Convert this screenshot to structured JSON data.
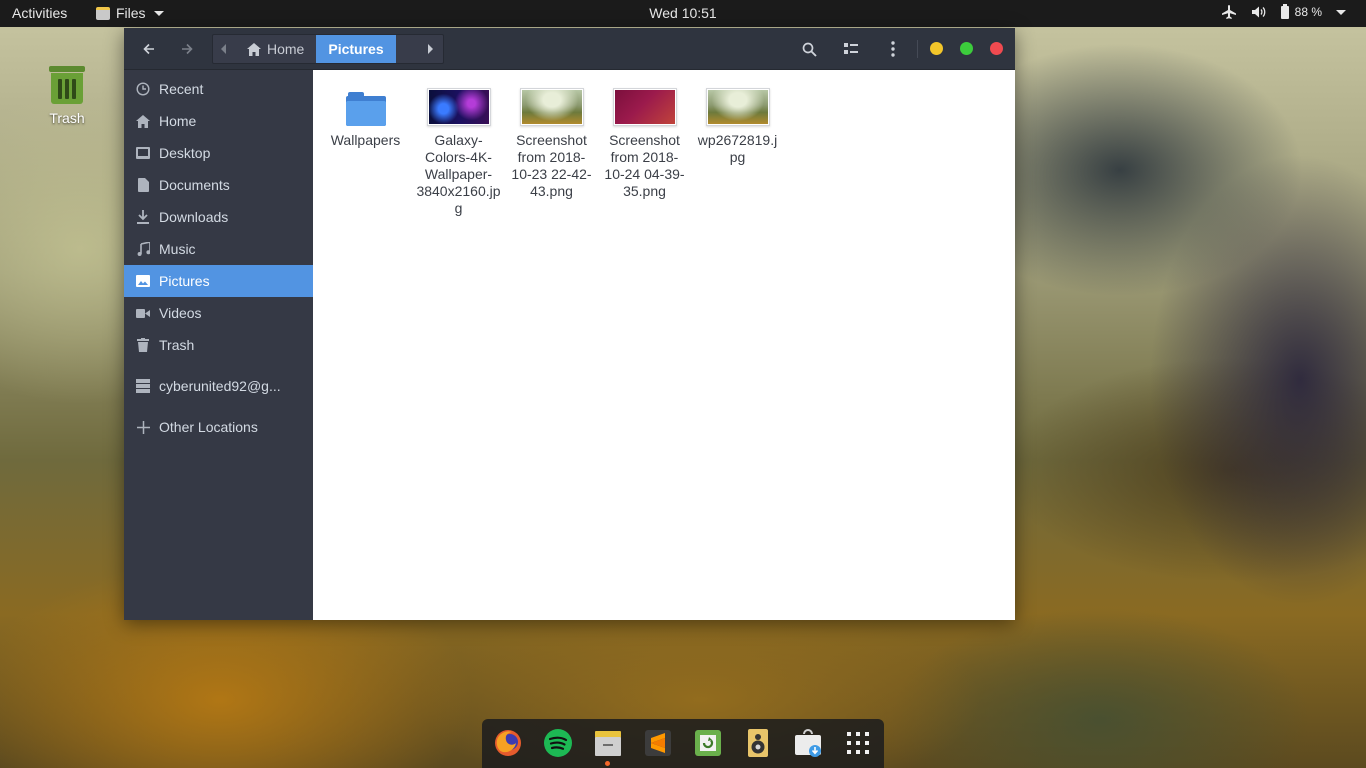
{
  "topbar": {
    "activities": "Activities",
    "app_name": "Files",
    "clock": "Wed 10:51",
    "battery_percent": "88 %"
  },
  "desktop": {
    "trash_label": "Trash"
  },
  "window": {
    "path": {
      "home": "Home",
      "current": "Pictures"
    },
    "sidebar": {
      "items": [
        {
          "label": "Recent",
          "icon": "clock-icon"
        },
        {
          "label": "Home",
          "icon": "home-icon"
        },
        {
          "label": "Desktop",
          "icon": "desktop-icon"
        },
        {
          "label": "Documents",
          "icon": "document-icon"
        },
        {
          "label": "Downloads",
          "icon": "download-icon"
        },
        {
          "label": "Music",
          "icon": "music-icon"
        },
        {
          "label": "Pictures",
          "icon": "image-icon"
        },
        {
          "label": "Videos",
          "icon": "video-icon"
        },
        {
          "label": "Trash",
          "icon": "trash-icon"
        }
      ],
      "network_item": "cyberunited92@g...",
      "other_locations": "Other Locations"
    },
    "files": [
      {
        "name": "Wallpapers",
        "type": "folder"
      },
      {
        "name": "Galaxy-Colors-4K-Wallpaper-3840x2160.jpg",
        "type": "image"
      },
      {
        "name": "Screenshot from 2018-10-23 22-42-43.png",
        "type": "image"
      },
      {
        "name": "Screenshot from 2018-10-24 04-39-35.png",
        "type": "image"
      },
      {
        "name": "wp2672819.jpg",
        "type": "image"
      }
    ]
  },
  "dock": {
    "apps": [
      "firefox-icon",
      "spotify-icon",
      "files-icon",
      "sublime-text-icon",
      "software-updater-icon",
      "rhythmbox-icon",
      "software-center-icon",
      "show-applications-icon"
    ]
  },
  "colors": {
    "accent": "#5294e2",
    "headerbar": "#2f343f",
    "sidebar": "#353945",
    "close": "#f04a50",
    "minimize": "#f3c62a",
    "maximize": "#3ccc3c"
  }
}
